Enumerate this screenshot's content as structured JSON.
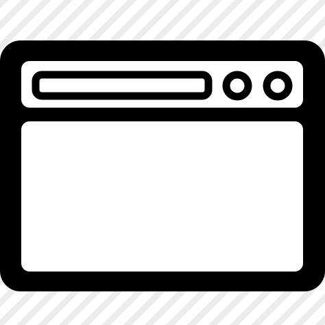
{
  "icon": {
    "name": "browser-window-icon",
    "stroke_color": "#000000",
    "fill_color": "#ffffff",
    "background": {
      "pattern": "diagonal-stripes",
      "base_color": "#ffffff",
      "stripe_color": "#ececec"
    },
    "parts": {
      "address_bar": "address-bar-icon",
      "window_buttons": [
        "window-button-icon",
        "window-button-icon"
      ],
      "content_area": "content-area"
    }
  }
}
